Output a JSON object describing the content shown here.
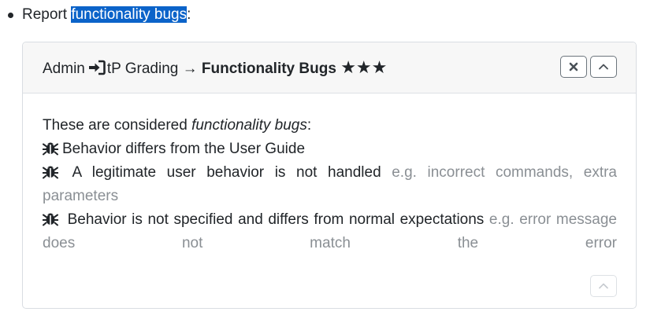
{
  "intro": {
    "prefix": "Report ",
    "highlight": "functionality bugs",
    "suffix": ":"
  },
  "card": {
    "title_part1": "Admin",
    "title_part2": "tP Grading → ",
    "title_bold": "Functionality Bugs",
    "stars": "★★★",
    "close_icon": "close-icon",
    "collapse_icon": "chevron-up-icon"
  },
  "body": {
    "lead": "These are considered ",
    "lead_italic": "functionality bugs",
    "lead_suffix": ":",
    "items": [
      {
        "text": "Behavior differs from the User Guide",
        "example": ""
      },
      {
        "text": "A legitimate user behavior is not handled",
        "example": "e.g. incorrect commands, extra parameters"
      },
      {
        "text": "Behavior is not specified and differs from normal expectations",
        "example": "e.g. error message does not match the error"
      }
    ]
  },
  "colors": {
    "selection": "#0b63c9",
    "muted": "#8a8f94",
    "header_bg": "#f7f7f7"
  }
}
